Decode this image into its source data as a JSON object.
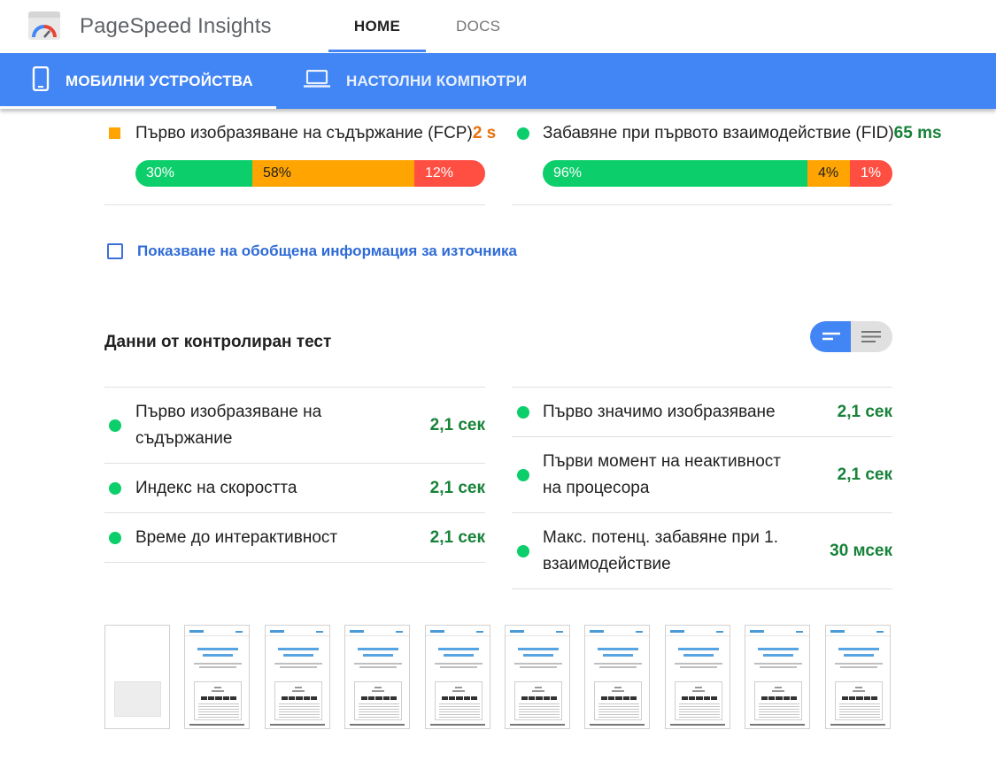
{
  "header": {
    "app_title": "PageSpeed Insights",
    "nav": [
      {
        "label": "HOME",
        "active": true
      },
      {
        "label": "DOCS",
        "active": false
      }
    ]
  },
  "device_tabs": [
    {
      "label": "МОБИЛНИ УСТРОЙСТВА",
      "icon": "smartphone-icon",
      "active": true
    },
    {
      "label": "НАСТОЛНИ КОМПЮТРИ",
      "icon": "laptop-icon",
      "active": false
    }
  ],
  "field_metrics": [
    {
      "name": "Първо изобразяване на съдържание (FCP)",
      "value": "2 s",
      "status": "average",
      "distribution": [
        "30%",
        "58%",
        "12%"
      ]
    },
    {
      "name": "Забавяне при първото взаимодействие (FID)",
      "value": "65 ms",
      "status": "fast",
      "distribution": [
        "96%",
        "4%",
        "1%"
      ]
    }
  ],
  "origin_summary": {
    "label": "Показване на обобщена информация за източника",
    "checked": false
  },
  "lab": {
    "title": "Данни от контролиран тест",
    "left": [
      {
        "name_line1": "Първо изобразяване на",
        "name_line2": "съдържание",
        "value": "2,1 сек"
      },
      {
        "name_line1": "Индекс на скоростта",
        "name_line2": "",
        "value": "2,1 сек"
      },
      {
        "name_line1": "Време до интерактивност",
        "name_line2": "",
        "value": "2,1 сек"
      }
    ],
    "right": [
      {
        "name_line1": "Първо значимо изобразяване",
        "name_line2": "",
        "value": "2,1 сек"
      },
      {
        "name_line1": "Първи момент на неактивност",
        "name_line2": "на процесора",
        "value": "2,1 сек"
      },
      {
        "name_line1": "Макс. потенц. забавяне при 1.",
        "name_line2": "взаимодействие",
        "value": "30 мсек"
      }
    ]
  },
  "colors": {
    "brand_blue": "#4285f4",
    "pass_green": "#0cce6b",
    "value_green": "#178239",
    "average_orange": "#ffa400",
    "fail_red": "#ff4e42"
  },
  "filmstrip": {
    "frame_count": 10,
    "first_frame_blank": true
  }
}
